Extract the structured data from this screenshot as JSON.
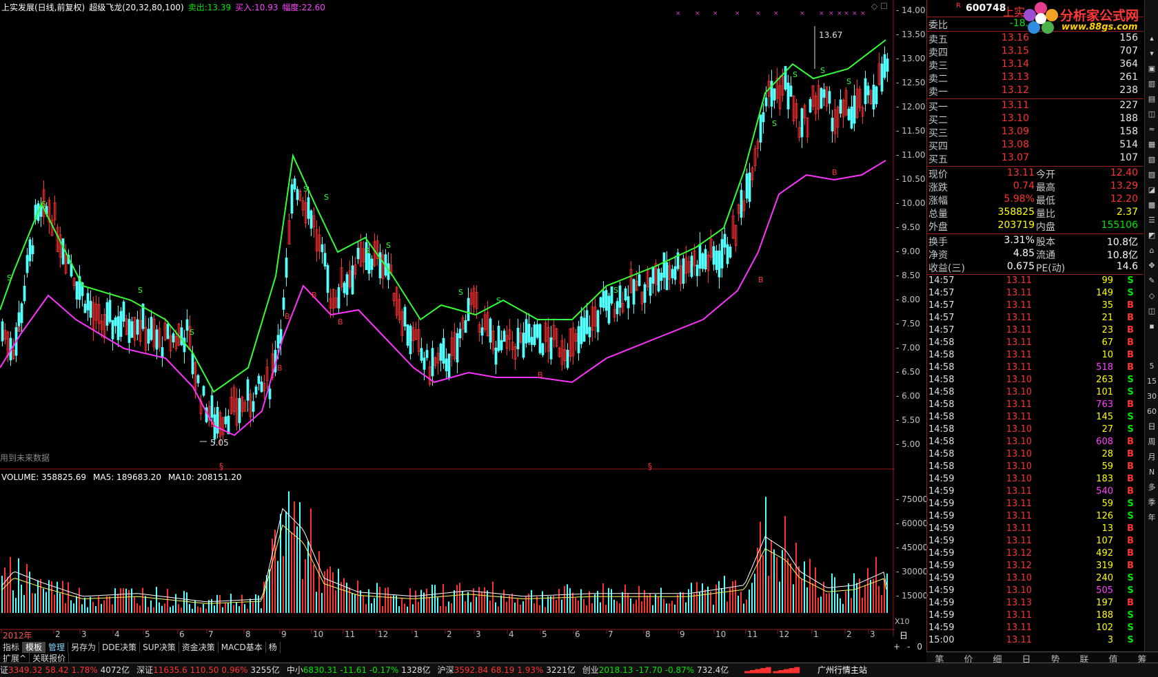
{
  "header": {
    "title": "上实发展(日线,前复权)",
    "indicator": "超级飞龙(20,32,80,100)",
    "sell_label": "卖出:",
    "sell_value": "13.39",
    "buy_label": "买入:",
    "buy_value": "10.93",
    "range_label": "幅度:",
    "range_value": "22.60"
  },
  "price_axis": [
    "14.00",
    "13.50",
    "13.00",
    "12.50",
    "12.00",
    "11.50",
    "11.00",
    "10.50",
    "10.00",
    "9.50",
    "9.00",
    "8.50",
    "8.00",
    "7.50",
    "7.00",
    "6.50",
    "6.00",
    "5.50",
    "5.00"
  ],
  "annotations": {
    "high_label": "13.67",
    "low_label": "5.05",
    "future_data_note": "用到未来数据",
    "section_mark_1": "§",
    "section_mark_2": "§"
  },
  "volume": {
    "header_volume": "VOLUME: 358825.69",
    "header_ma5": "MA5: 189683.20",
    "header_ma10": "MA10: 208151.20",
    "axis": [
      "75000",
      "60000",
      "45000",
      "30000",
      "15000"
    ],
    "unit": "X10"
  },
  "months": [
    "2012年",
    "2",
    "3",
    "4",
    "5",
    "6",
    "7",
    "8",
    "9",
    "10",
    "11",
    "12",
    "1",
    "2",
    "3",
    "4",
    "5",
    "6",
    "7",
    "8",
    "9",
    "10",
    "11",
    "12",
    "1",
    "2",
    "3"
  ],
  "period_label": "日线",
  "right_panel": {
    "r_marker": "R",
    "code": "600748",
    "name": "上实",
    "ratio_label": "委比",
    "ratio_value": "-18.2",
    "asks": [
      {
        "label": "卖五",
        "price": "13.16",
        "vol": "156"
      },
      {
        "label": "卖四",
        "price": "13.15",
        "vol": "707"
      },
      {
        "label": "卖三",
        "price": "13.14",
        "vol": "364"
      },
      {
        "label": "卖二",
        "price": "13.13",
        "vol": "261"
      },
      {
        "label": "卖一",
        "price": "13.12",
        "vol": "238"
      }
    ],
    "bids": [
      {
        "label": "买一",
        "price": "13.11",
        "vol": "227"
      },
      {
        "label": "买二",
        "price": "13.10",
        "vol": "188"
      },
      {
        "label": "买三",
        "price": "13.09",
        "vol": "158"
      },
      {
        "label": "买四",
        "price": "13.08",
        "vol": "514"
      },
      {
        "label": "买五",
        "price": "13.07",
        "vol": "107"
      }
    ],
    "quote": [
      {
        "l1": "现价",
        "v1": "13.11",
        "l2": "今开",
        "v2": "12.40"
      },
      {
        "l1": "涨跌",
        "v1": "0.74",
        "l2": "最高",
        "v2": "13.29"
      },
      {
        "l1": "涨幅",
        "v1": "5.98%",
        "l2": "最低",
        "v2": "12.20"
      },
      {
        "l1": "总量",
        "v1": "358825",
        "l2": "量比",
        "v2": "2.37"
      },
      {
        "l1": "外盘",
        "v1": "203719",
        "l2": "内盘",
        "v2": "155106"
      }
    ],
    "fund": [
      {
        "l1": "换手",
        "v1": "3.31%",
        "l2": "股本",
        "v2": "10.8亿"
      },
      {
        "l1": "净资",
        "v1": "4.85",
        "l2": "流通",
        "v2": "10.8亿"
      },
      {
        "l1": "收益(三)",
        "v1": "0.675",
        "l2": "PE(动)",
        "v2": "14.6"
      }
    ],
    "ticks": [
      {
        "t": "14:57",
        "p": "13.11",
        "v": "99",
        "d": "S"
      },
      {
        "t": "14:57",
        "p": "13.11",
        "v": "149",
        "d": "S"
      },
      {
        "t": "14:57",
        "p": "13.11",
        "v": "35",
        "d": "B"
      },
      {
        "t": "14:57",
        "p": "13.11",
        "v": "21",
        "d": "B"
      },
      {
        "t": "14:57",
        "p": "13.11",
        "v": "23",
        "d": "B"
      },
      {
        "t": "14:58",
        "p": "13.11",
        "v": "67",
        "d": "B"
      },
      {
        "t": "14:58",
        "p": "13.11",
        "v": "10",
        "d": "B"
      },
      {
        "t": "14:58",
        "p": "13.11",
        "v": "518",
        "d": "B"
      },
      {
        "t": "14:58",
        "p": "13.10",
        "v": "263",
        "d": "S"
      },
      {
        "t": "14:58",
        "p": "13.10",
        "v": "101",
        "d": "S"
      },
      {
        "t": "14:58",
        "p": "13.11",
        "v": "763",
        "d": "B"
      },
      {
        "t": "14:58",
        "p": "13.11",
        "v": "145",
        "d": "S"
      },
      {
        "t": "14:58",
        "p": "13.10",
        "v": "27",
        "d": "S"
      },
      {
        "t": "14:58",
        "p": "13.10",
        "v": "608",
        "d": "B"
      },
      {
        "t": "14:58",
        "p": "13.10",
        "v": "28",
        "d": "B"
      },
      {
        "t": "14:58",
        "p": "13.10",
        "v": "59",
        "d": "B"
      },
      {
        "t": "14:59",
        "p": "13.10",
        "v": "183",
        "d": "B"
      },
      {
        "t": "14:59",
        "p": "13.11",
        "v": "540",
        "d": "B"
      },
      {
        "t": "14:59",
        "p": "13.11",
        "v": "59",
        "d": "S"
      },
      {
        "t": "14:59",
        "p": "13.11",
        "v": "126",
        "d": "S"
      },
      {
        "t": "14:59",
        "p": "13.11",
        "v": "13",
        "d": "B"
      },
      {
        "t": "14:59",
        "p": "13.11",
        "v": "107",
        "d": "B"
      },
      {
        "t": "14:59",
        "p": "13.12",
        "v": "492",
        "d": "B"
      },
      {
        "t": "14:59",
        "p": "13.12",
        "v": "319",
        "d": "B"
      },
      {
        "t": "14:59",
        "p": "13.10",
        "v": "240",
        "d": "S"
      },
      {
        "t": "14:59",
        "p": "13.10",
        "v": "505",
        "d": "S"
      },
      {
        "t": "14:59",
        "p": "13.13",
        "v": "197",
        "d": "B"
      },
      {
        "t": "14:59",
        "p": "13.11",
        "v": "188",
        "d": "S"
      },
      {
        "t": "14:59",
        "p": "13.11",
        "v": "102",
        "d": "S"
      },
      {
        "t": "15:00",
        "p": "13.11",
        "v": "3",
        "d": "S"
      }
    ],
    "bottom_tabs": [
      "笔",
      "价",
      "细",
      "日",
      "势",
      "联",
      "值",
      "筹"
    ]
  },
  "logo": {
    "title": "分析家公式网",
    "url": "www.88gs.com"
  },
  "toolbar": [
    "5",
    "15",
    "30",
    "60",
    "日",
    "周",
    "月",
    "N",
    "多",
    "季",
    "年"
  ],
  "tabs": [
    "指标",
    "模板",
    "管理",
    "另存为",
    "DDE决策",
    "SUP决策",
    "资金决策",
    "MACD基本",
    "杨"
  ],
  "tabs_right": [
    "+",
    "-",
    "0"
  ],
  "tabs2": [
    "扩展^",
    "关联报价"
  ],
  "status": [
    {
      "name": "证",
      "val": "3349.32",
      "chg": "58.42",
      "pct": "1.78%",
      "amt": "4072亿",
      "up": true
    },
    {
      "name": "深证",
      "val": "11635.6",
      "chg": "110.50",
      "pct": "0.96%",
      "amt": "3255亿",
      "up": true
    },
    {
      "name": "中小",
      "val": "6830.31",
      "chg": "-11.61",
      "pct": "-0.17%",
      "amt": "1328亿",
      "up": false
    },
    {
      "name": "沪深",
      "val": "3592.84",
      "chg": "68.19",
      "pct": "1.93%",
      "amt": "3221亿",
      "up": true
    },
    {
      "name": "创业",
      "val": "2018.13",
      "chg": "-17.70",
      "pct": "-0.87%",
      "amt": "732.4亿",
      "up": false
    }
  ],
  "status_right": "广州行情主站",
  "colors": {
    "up": "#ff3232",
    "down": "#54ffff",
    "upper_band": "#33ff33",
    "lower_band": "#ff33ff",
    "grid": "#9a1a1a"
  }
}
